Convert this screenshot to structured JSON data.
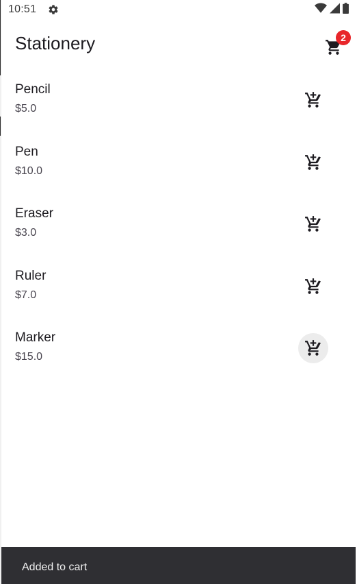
{
  "status_bar": {
    "time": "10:51",
    "icons": [
      "gear-icon",
      "wifi-icon",
      "signal-icon",
      "battery-icon"
    ]
  },
  "app_bar": {
    "title": "Stationery",
    "cart_badge_count": "2",
    "cart_icon": "shopping-cart-icon"
  },
  "products": [
    {
      "name": "Pencil",
      "price": "$5.0",
      "pressed": false
    },
    {
      "name": "Pen",
      "price": "$10.0",
      "pressed": false
    },
    {
      "name": "Eraser",
      "price": "$3.0",
      "pressed": false
    },
    {
      "name": "Ruler",
      "price": "$7.0",
      "pressed": false
    },
    {
      "name": "Marker",
      "price": "$15.0",
      "pressed": true
    }
  ],
  "snackbar": {
    "message": "Added to cart"
  },
  "colors": {
    "badge": "#e8262a",
    "snackbar_bg": "#2f2f33",
    "text_primary": "#1d1b20"
  }
}
